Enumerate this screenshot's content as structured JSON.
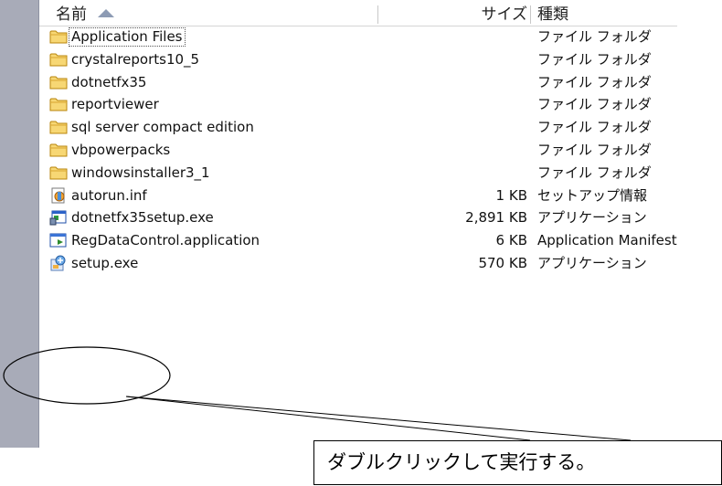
{
  "columns": {
    "name": "名前",
    "size": "サイズ",
    "type": "種類"
  },
  "files": [
    {
      "name": "Application Files",
      "size": "",
      "type": "ファイル フォルダ",
      "icon": "folder-icon",
      "focused": true
    },
    {
      "name": "crystalreports10_5",
      "size": "",
      "type": "ファイル フォルダ",
      "icon": "folder-icon"
    },
    {
      "name": "dotnetfx35",
      "size": "",
      "type": "ファイル フォルダ",
      "icon": "folder-icon"
    },
    {
      "name": "reportviewer",
      "size": "",
      "type": "ファイル フォルダ",
      "icon": "folder-icon"
    },
    {
      "name": "sql server compact edition",
      "size": "",
      "type": "ファイル フォルダ",
      "icon": "folder-icon"
    },
    {
      "name": "vbpowerpacks",
      "size": "",
      "type": "ファイル フォルダ",
      "icon": "folder-icon"
    },
    {
      "name": "windowsinstaller3_1",
      "size": "",
      "type": "ファイル フォルダ",
      "icon": "folder-icon"
    },
    {
      "name": "autorun.inf",
      "size": "1 KB",
      "type": "セットアップ情報",
      "icon": "setup-info-icon"
    },
    {
      "name": "dotnetfx35setup.exe",
      "size": "2,891 KB",
      "type": "アプリケーション",
      "icon": "exe-app-icon"
    },
    {
      "name": "RegDataControl.application",
      "size": "6 KB",
      "type": "Application Manifest",
      "icon": "application-manifest-icon"
    },
    {
      "name": "setup.exe",
      "size": "570 KB",
      "type": "アプリケーション",
      "icon": "setup-exe-icon"
    }
  ],
  "callout": {
    "text": "ダブルクリックして実行する。"
  },
  "colors": {
    "folder": "#f0c64a",
    "folder_border": "#b8860b",
    "left_strip": "#a8abb8"
  }
}
